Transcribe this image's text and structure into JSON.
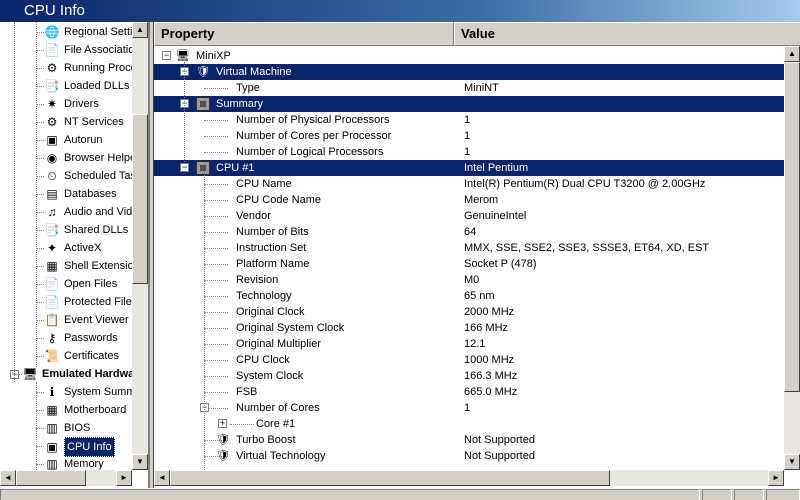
{
  "window": {
    "title": "CPU Info"
  },
  "sidebar": {
    "items": [
      {
        "label": "Regional Settings",
        "icon": "regional-settings-icon",
        "glyph": "🌐"
      },
      {
        "label": "File Associations",
        "icon": "file-associations-icon",
        "glyph": "📄"
      },
      {
        "label": "Running Processes",
        "icon": "running-processes-icon",
        "glyph": "⚙"
      },
      {
        "label": "Loaded DLLs",
        "icon": "loaded-dlls-icon",
        "glyph": "📑"
      },
      {
        "label": "Drivers",
        "icon": "drivers-icon",
        "glyph": "✷"
      },
      {
        "label": "NT Services",
        "icon": "nt-services-icon",
        "glyph": "⚙"
      },
      {
        "label": "Autorun",
        "icon": "autorun-icon",
        "glyph": "▣"
      },
      {
        "label": "Browser Helper Objects",
        "icon": "browser-helper-icon",
        "glyph": "◉"
      },
      {
        "label": "Scheduled Tasks",
        "icon": "scheduled-tasks-icon",
        "glyph": "⏲"
      },
      {
        "label": "Databases",
        "icon": "databases-icon",
        "glyph": "▤"
      },
      {
        "label": "Audio and Video Codecs",
        "icon": "codecs-icon",
        "glyph": "♫"
      },
      {
        "label": "Shared DLLs",
        "icon": "shared-dlls-icon",
        "glyph": "📑"
      },
      {
        "label": "ActiveX",
        "icon": "activex-icon",
        "glyph": "✦"
      },
      {
        "label": "Shell Extensions",
        "icon": "shell-extensions-icon",
        "glyph": "▦"
      },
      {
        "label": "Open Files",
        "icon": "open-files-icon",
        "glyph": "📄"
      },
      {
        "label": "Protected Files",
        "icon": "protected-files-icon",
        "glyph": "📄"
      },
      {
        "label": "Event Viewer",
        "icon": "event-viewer-icon",
        "glyph": "📋"
      },
      {
        "label": "Passwords",
        "icon": "passwords-icon",
        "glyph": "⚷"
      },
      {
        "label": "Certificates",
        "icon": "certificates-icon",
        "glyph": "📜"
      },
      {
        "label": "Emulated Hardware",
        "icon": "emulated-hardware-icon",
        "glyph": "🖥"
      },
      {
        "label": "System Summary",
        "icon": "system-summary-icon",
        "glyph": "ℹ"
      },
      {
        "label": "Motherboard",
        "icon": "motherboard-icon",
        "glyph": "▦"
      },
      {
        "label": "BIOS",
        "icon": "bios-icon",
        "glyph": "▥"
      },
      {
        "label": "CPU Info",
        "icon": "cpu-info-icon",
        "glyph": "▣"
      },
      {
        "label": "Memory",
        "icon": "memory-icon",
        "glyph": "▥"
      }
    ]
  },
  "columns": {
    "property": "Property",
    "value": "Value"
  },
  "rows": [
    {
      "name": "MiniXP",
      "value": "",
      "kind": "root",
      "icon": "computer-icon",
      "glyph": "🖥"
    },
    {
      "name": "Virtual Machine",
      "value": "",
      "kind": "group",
      "icon": "shield-icon",
      "glyph": "🛡"
    },
    {
      "name": "Type",
      "value": "MiniNT",
      "kind": "item"
    },
    {
      "name": "Summary",
      "value": "",
      "kind": "group",
      "icon": "chip-icon"
    },
    {
      "name": "Number of Physical Processors",
      "value": "1",
      "kind": "item"
    },
    {
      "name": "Number of Cores per Processor",
      "value": "1",
      "kind": "item"
    },
    {
      "name": "Number of Logical Processors",
      "value": "1",
      "kind": "item"
    },
    {
      "name": "CPU #1",
      "value": "Intel Pentium",
      "kind": "group",
      "icon": "chip-icon"
    },
    {
      "name": "CPU Name",
      "value": "Intel(R) Pentium(R) Dual CPU T3200 @ 2.00GHz",
      "kind": "item"
    },
    {
      "name": "CPU Code Name",
      "value": "Merom",
      "kind": "item"
    },
    {
      "name": "Vendor",
      "value": "GenuineIntel",
      "kind": "item"
    },
    {
      "name": "Number of Bits",
      "value": "64",
      "kind": "item"
    },
    {
      "name": "Instruction Set",
      "value": "MMX, SSE, SSE2, SSE3, SSSE3, ET64, XD, EST",
      "kind": "item"
    },
    {
      "name": "Platform Name",
      "value": "Socket P (478)",
      "kind": "item"
    },
    {
      "name": "Revision",
      "value": "M0",
      "kind": "item"
    },
    {
      "name": "Technology",
      "value": "65 nm",
      "kind": "item"
    },
    {
      "name": "Original Clock",
      "value": "2000 MHz",
      "kind": "item"
    },
    {
      "name": "Original System Clock",
      "value": "166 MHz",
      "kind": "item"
    },
    {
      "name": "Original Multiplier",
      "value": "12.1",
      "kind": "item"
    },
    {
      "name": "CPU Clock",
      "value": "1000 MHz",
      "kind": "item"
    },
    {
      "name": "System Clock",
      "value": "166.3 MHz",
      "kind": "item"
    },
    {
      "name": "FSB",
      "value": "665.0 MHz",
      "kind": "item"
    },
    {
      "name": "Number of Cores",
      "value": "1",
      "kind": "subgroup"
    },
    {
      "name": "Core #1",
      "value": "",
      "kind": "subitem"
    },
    {
      "name": "Turbo Boost",
      "value": "Not Supported",
      "kind": "item",
      "icon": "shield-icon",
      "glyph": "🛡"
    },
    {
      "name": "Virtual Technology",
      "value": "Not Supported",
      "kind": "item",
      "icon": "shield-icon",
      "glyph": "🛡"
    }
  ],
  "scroll_arrows": {
    "up": "▲",
    "down": "▼",
    "left": "◄",
    "right": "►"
  },
  "tree_glyphs": {
    "expanded": "−",
    "collapsed": "+"
  }
}
